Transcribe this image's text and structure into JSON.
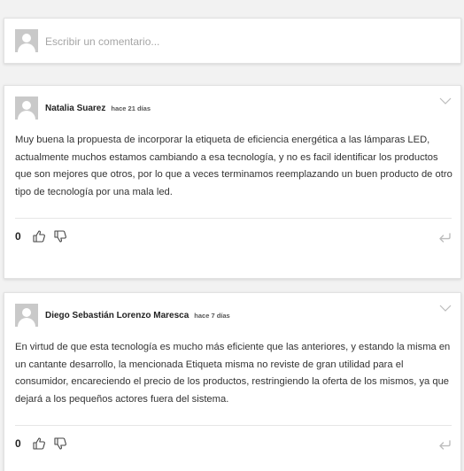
{
  "composer": {
    "placeholder": "Escribir un comentario..."
  },
  "comments": [
    {
      "author": "Natalia Suarez",
      "time": "hace 21 días",
      "text": "Muy buena la propuesta de incorporar la etiqueta de eficiencia energética a las lámparas LED, actualmente muchos estamos cambiando a esa tecnología, y no es facil identificar los productos que son mejores que otros, por lo que a veces terminamos reemplazando un buen producto de otro tipo de tecnología por una mala led.",
      "score": "0"
    },
    {
      "author": "Diego Sebastián Lorenzo Maresca",
      "time": "hace 7 días",
      "text": "En virtud de que esta tecnología es mucho más eficiente que las anteriores, y estando la misma en un cantante desarrollo, la mencionada Etiqueta misma no reviste de gran utilidad para el consumidor, encareciendo el precio de los productos, restringiendo la oferta de los mismos, ya que dejará a los pequeños actores fuera del sistema.",
      "score": "0"
    }
  ],
  "icons": {
    "avatar": "user-placeholder-icon",
    "menu": "chevron-down-icon",
    "like": "thumbs-up-icon",
    "dislike": "thumbs-down-icon",
    "reply": "reply-icon"
  }
}
